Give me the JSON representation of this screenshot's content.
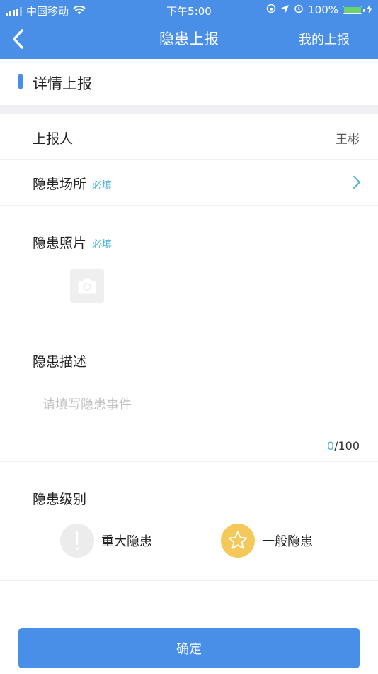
{
  "status_bar": {
    "carrier": "中国移动",
    "time": "下午5:00",
    "battery": "100%"
  },
  "nav": {
    "title": "隐患上报",
    "right_action": "我的上报"
  },
  "section": {
    "title": "详情上报"
  },
  "form": {
    "reporter": {
      "label": "上报人",
      "value": "王彬"
    },
    "location": {
      "label": "隐患场所",
      "required": "必填"
    },
    "photo": {
      "label": "隐患照片",
      "required": "必填"
    },
    "description": {
      "label": "隐患描述",
      "placeholder": "请填写隐患事件",
      "count": "0",
      "max": "/100"
    },
    "level": {
      "label": "隐患级别",
      "options": [
        "重大隐患",
        "一般隐患"
      ]
    }
  },
  "confirm_label": "确定",
  "colors": {
    "primary": "#4a8fe7",
    "required": "#4fb3d9",
    "selected_level": "#f5c85a",
    "unselected_level": "#ececec"
  }
}
